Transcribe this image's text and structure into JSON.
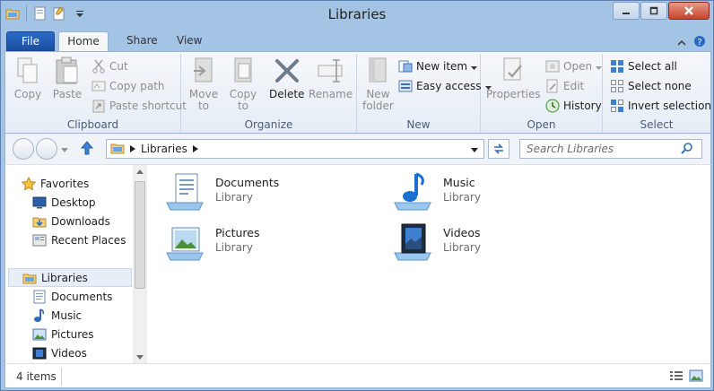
{
  "window": {
    "title": "Libraries"
  },
  "ribbon": {
    "tabs": [
      "File",
      "Home",
      "Share",
      "View"
    ],
    "groups": {
      "clipboard": {
        "label": "Clipboard",
        "copy": "Copy",
        "paste": "Paste",
        "cut": "Cut",
        "copy_path": "Copy path",
        "paste_shortcut": "Paste shortcut"
      },
      "organize": {
        "label": "Organize",
        "move_to": "Move\nto",
        "copy_to": "Copy\nto",
        "delete": "Delete",
        "rename": "Rename"
      },
      "new": {
        "label": "New",
        "new_folder": "New\nfolder",
        "new_item": "New item",
        "easy_access": "Easy access"
      },
      "open": {
        "label": "Open",
        "properties": "Properties",
        "open": "Open",
        "edit": "Edit",
        "history": "History"
      },
      "select": {
        "label": "Select",
        "select_all": "Select all",
        "select_none": "Select none",
        "invert_selection": "Invert selection"
      }
    }
  },
  "address": {
    "path": "Libraries",
    "search_placeholder": "Search Libraries"
  },
  "navigation": {
    "favorites": "Favorites",
    "favorite_items": [
      "Desktop",
      "Downloads",
      "Recent Places"
    ],
    "libraries": "Libraries",
    "library_items": [
      "Documents",
      "Music",
      "Pictures",
      "Videos"
    ]
  },
  "items": [
    {
      "name": "Documents",
      "type": "Library"
    },
    {
      "name": "Music",
      "type": "Library"
    },
    {
      "name": "Pictures",
      "type": "Library"
    },
    {
      "name": "Videos",
      "type": "Library"
    }
  ],
  "status": {
    "count": "4 items"
  },
  "colors": {
    "frame": "#a4c4e6",
    "file_tab": "#1b4f9e",
    "accent": "#1e78d7"
  }
}
